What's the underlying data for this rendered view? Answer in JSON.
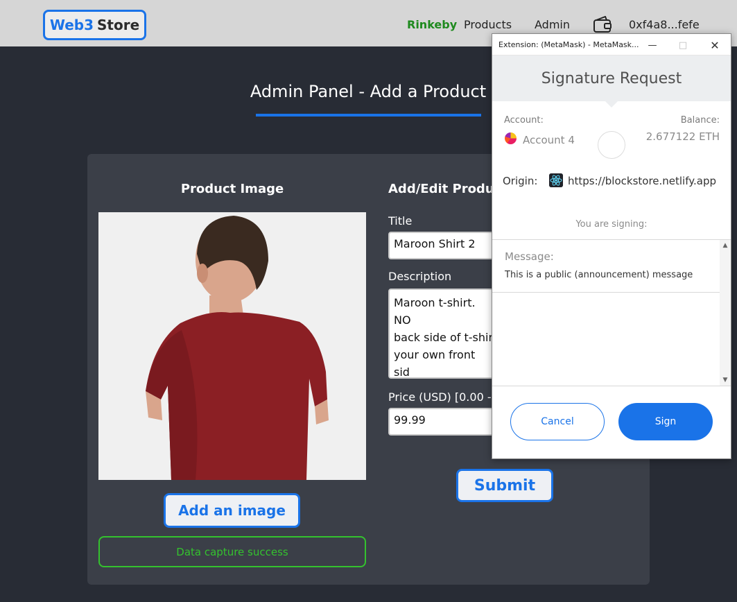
{
  "header": {
    "logo_part1": "Web3",
    "logo_part2": "Store",
    "network": "Rinkeby",
    "nav_products": "Products",
    "nav_admin": "Admin",
    "account_address": "0xf4a8...fefe"
  },
  "page": {
    "title": "Admin Panel - Add a Product"
  },
  "image_section": {
    "heading": "Product Image",
    "add_image_label": "Add an image",
    "status_message": "Data capture success"
  },
  "form": {
    "heading": "Add/Edit Produc",
    "title_label": "Title",
    "title_value": "Maroon Shirt 2",
    "description_label": "Description",
    "description_lines": [
      "Maroon t-shirt. NO",
      "back side of t-shir",
      "your own front sid"
    ],
    "price_label": "Price (USD) [0.00 -",
    "price_value": "99.99",
    "submit_label": "Submit"
  },
  "metamask": {
    "window_title": "Extension: (MetaMask) - MetaMask...",
    "header_title": "Signature Request",
    "account_label": "Account:",
    "account_name": "Account 4",
    "balance_label": "Balance:",
    "balance_value": "2.677122 ETH",
    "origin_label": "Origin:",
    "origin_url": "https://blockstore.netlify.app",
    "signing_label": "You are signing:",
    "message_label": "Message:",
    "message_text": "This is a public (announcement) message",
    "cancel_label": "Cancel",
    "sign_label": "Sign"
  },
  "colors": {
    "accent_blue": "#1a73e8",
    "success_green": "#34c22e",
    "network_green": "#1e8a1e",
    "page_bg": "#282c35",
    "panel_bg": "#3b3f48"
  }
}
